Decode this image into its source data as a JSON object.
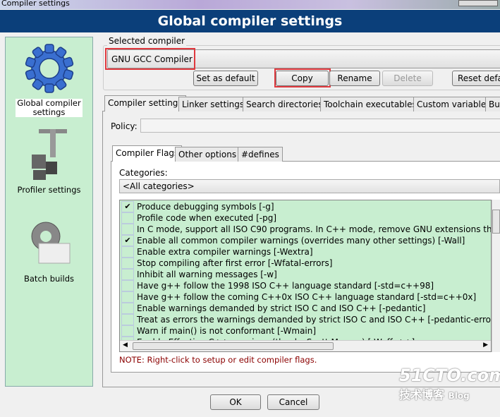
{
  "window": {
    "title": "Compiler settings"
  },
  "header": {
    "title": "Global compiler settings"
  },
  "sidebar": {
    "items": [
      {
        "label": "Global compiler settings",
        "icon": "gear-icon"
      },
      {
        "label": "Profiler settings",
        "icon": "caliper-icon"
      },
      {
        "label": "Batch builds",
        "icon": "gear-stack-icon"
      }
    ]
  },
  "compiler": {
    "group_label": "Selected compiler",
    "selected": "GNU GCC Compiler",
    "buttons": {
      "set_default": "Set as default",
      "copy": "Copy",
      "rename": "Rename",
      "delete": "Delete",
      "reset": "Reset defa"
    }
  },
  "tabs": [
    "Compiler settings",
    "Linker settings",
    "Search directories",
    "Toolchain executables",
    "Custom variables",
    "Bui"
  ],
  "policy": {
    "label": "Policy:",
    "value": ""
  },
  "subtabs": [
    "Compiler Flags",
    "Other options",
    "#defines"
  ],
  "categories": {
    "label": "Categories:",
    "selected": "<All categories>"
  },
  "flags": [
    {
      "label": "Produce debugging symbols  [-g]",
      "checked": true
    },
    {
      "label": "Profile code when executed  [-pg]",
      "checked": false
    },
    {
      "label": "In C mode, support all ISO C90 programs. In C++ mode, remove GNU extensions that conflic",
      "checked": false
    },
    {
      "label": "Enable all common compiler warnings (overrides many other settings)  [-Wall]",
      "checked": true
    },
    {
      "label": "Enable extra compiler warnings  [-Wextra]",
      "checked": false
    },
    {
      "label": "Stop compiling after first error  [-Wfatal-errors]",
      "checked": false
    },
    {
      "label": "Inhibit all warning messages  [-w]",
      "checked": false
    },
    {
      "label": "Have g++ follow the 1998 ISO C++ language standard  [-std=c++98]",
      "checked": false
    },
    {
      "label": "Have g++ follow the coming C++0x ISO C++ language standard  [-std=c++0x]",
      "checked": false
    },
    {
      "label": "Enable warnings demanded by strict ISO C and ISO C++  [-pedantic]",
      "checked": false
    },
    {
      "label": "Treat as errors the warnings demanded by strict ISO C and ISO C++  [-pedantic-errors]",
      "checked": false
    },
    {
      "label": "Warn if main() is not conformant  [-Wmain]",
      "checked": false
    },
    {
      "label": "Enable Effective-C++ warnings (thanks Scott Meyers)  [-Weffc++]",
      "checked": false
    }
  ],
  "note": "NOTE: Right-click to setup or edit compiler flags.",
  "footer": {
    "ok": "OK",
    "cancel": "Cancel"
  },
  "watermark": {
    "text": "51CTO.com",
    "sub": "技术博客",
    "blog": "Blog"
  },
  "colors": {
    "header": "#0b3f7a",
    "panel": "#c8eed0",
    "highlight": "#e0393e",
    "note": "#8b0000"
  }
}
